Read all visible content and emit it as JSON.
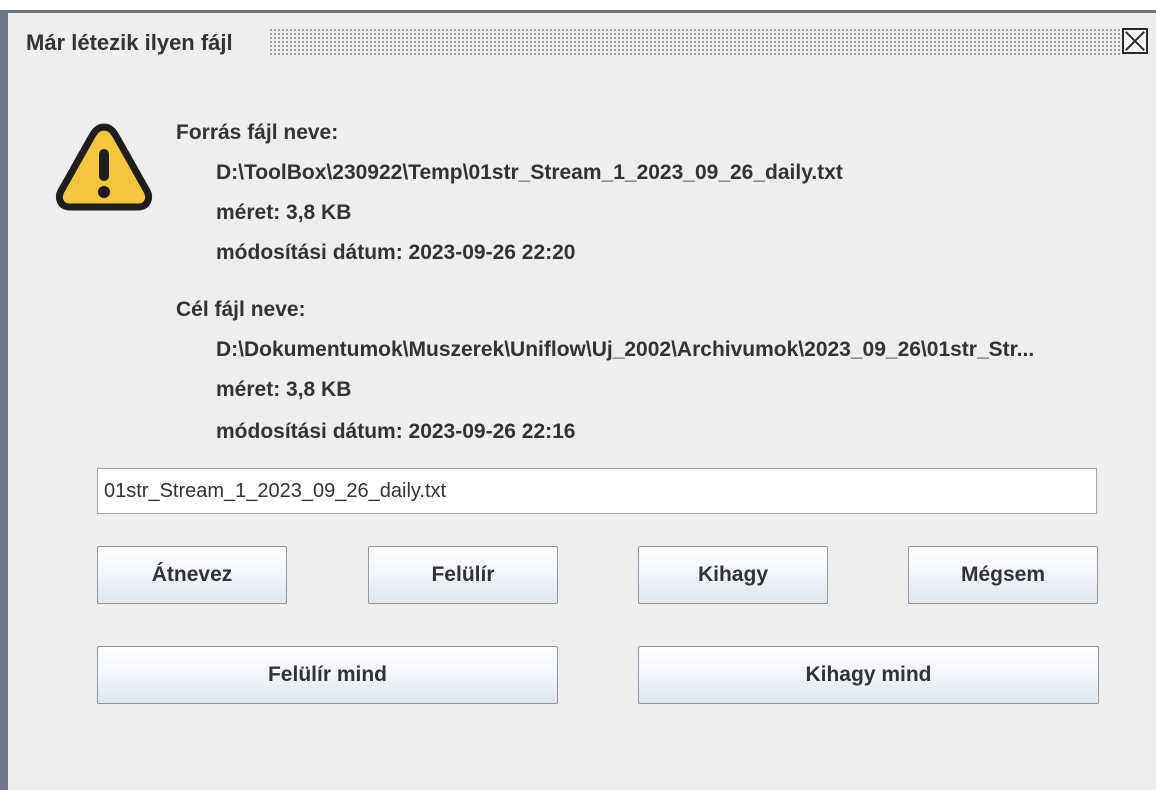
{
  "window": {
    "title": "Már létezik ilyen fájl"
  },
  "source": {
    "heading": "Forrás fájl neve:",
    "path": "D:\\ToolBox\\230922\\Temp\\01str_Stream_1_2023_09_26_daily.txt",
    "size": "méret: 3,8 KB",
    "modified": "módosítási dátum: 2023-09-26 22:20"
  },
  "target": {
    "heading": "Cél fájl neve:",
    "path": "D:\\Dokumentumok\\Muszerek\\Uniflow\\Uj_2002\\Archivumok\\2023_09_26\\01str_Str...",
    "size": "méret: 3,8 KB",
    "modified": "módosítási dátum: 2023-09-26 22:16"
  },
  "filename_input": {
    "value": "01str_Stream_1_2023_09_26_daily.txt"
  },
  "buttons": {
    "rename": "Átnevez",
    "overwrite": "Felülír",
    "skip": "Kihagy",
    "cancel": "Mégsem",
    "overwrite_all": "Felülír mind",
    "skip_all": "Kihagy mind"
  },
  "icons": {
    "warning": "warning-icon",
    "close": "close-icon"
  },
  "colors": {
    "warning_fill": "#f5c63c",
    "warning_outline": "#1e1e1e",
    "window_bg": "#eeeeee",
    "window_border": "#6f7785"
  }
}
